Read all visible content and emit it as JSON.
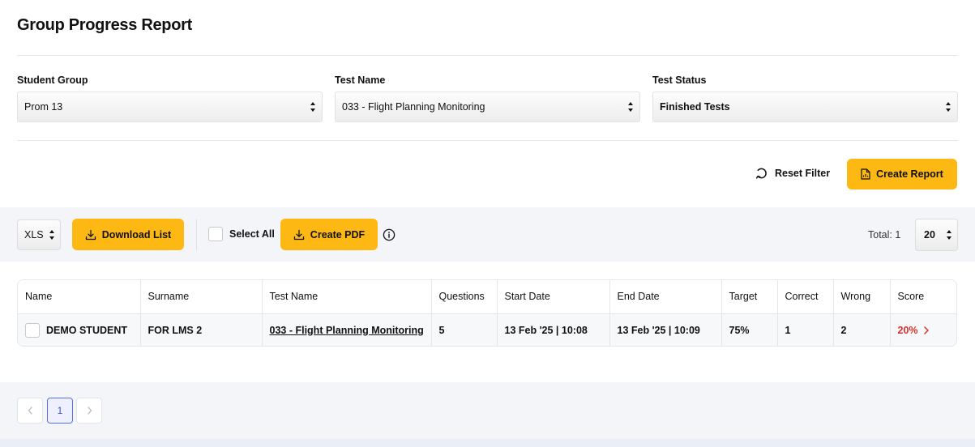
{
  "page": {
    "title": "Group Progress Report"
  },
  "filters": {
    "student_group": {
      "label": "Student Group",
      "value": "Prom 13"
    },
    "test_name": {
      "label": "Test Name",
      "value": "033 - Flight Planning Monitoring"
    },
    "test_status": {
      "label": "Test Status",
      "value": "Finished Tests"
    }
  },
  "actions": {
    "reset_filter": "Reset Filter",
    "create_report": "Create Report"
  },
  "toolbar": {
    "format_value": "XLS",
    "download_list": "Download List",
    "select_all": "Select All",
    "create_pdf": "Create PDF",
    "total": "Total: 1",
    "page_size": "20"
  },
  "table": {
    "headers": [
      "Name",
      "Surname",
      "Test Name",
      "Questions",
      "Start Date",
      "End Date",
      "Target",
      "Correct",
      "Wrong",
      "Score"
    ],
    "rows": [
      {
        "name": "DEMO STUDENT",
        "surname": "FOR LMS 2",
        "test_name": "033 - Flight Planning Monitoring",
        "questions": "5",
        "start_date": "13 Feb '25 | 10:08",
        "end_date": "13 Feb '25 | 10:09",
        "target": "75%",
        "correct": "1",
        "wrong": "2",
        "score": "20%"
      }
    ]
  },
  "pagination": {
    "current_page": "1"
  },
  "colors": {
    "accent_yellow": "#fdb813",
    "score_red": "#d9302c",
    "pager_active": "#3d4fd1"
  }
}
